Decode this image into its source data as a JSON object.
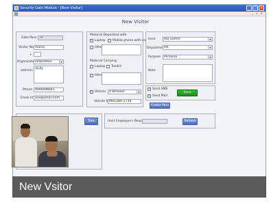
{
  "window": {
    "title": "Security Gate Module - [New Visitor]"
  },
  "form_title": "New Visitor",
  "visitor": {
    "gate_pass_label": "Gate Pass no.",
    "gate_pass_value": "34",
    "name_label": "Visitor Name",
    "name_value": "manoj",
    "plus": "+",
    "org_label": "Organization",
    "org_value": "embedded",
    "address_label": "address",
    "address_value": "dcjdy",
    "phone_label": "Phone",
    "phone_value": "9990096641",
    "email_label": "Email Id",
    "email_value": "xxx@ymail.com"
  },
  "material_deposit": {
    "title": "Material Deposited with",
    "laptop": "Laptop",
    "laptop_checked": true,
    "mobile_camera": "Mobile phone with camera",
    "mobile_camera_checked": false,
    "other": "Other",
    "other_checked": false
  },
  "material_carrying": {
    "title": "Material Carrying",
    "laptop": "Laptop",
    "toolkit": "Toolkit",
    "other": "Other",
    "vehicle": "Vehicle",
    "vehicle_checked": true,
    "vehicle_type": "4 Wheeler",
    "vehicle_no_label": "Vehicle No",
    "vehicle_no_value": "MH12BH 2739"
  },
  "meeting": {
    "host_label": "Host",
    "host_value": "Raj Gamre",
    "dept_label": "Department",
    "dept_value": "sdi",
    "purpose_label": "Purpose",
    "purpose_value": "Personal",
    "note_label": "Note"
  },
  "notify": {
    "send_sms": "Send SMS",
    "send_sms_checked": true,
    "send_mail": "Send Mail",
    "send_mail_checked": true,
    "save": "Save",
    "create_pass": "Create Pass"
  },
  "photo": {
    "take_photo": "Take Photo"
  },
  "response": {
    "label": "Host Employee's Response",
    "refresh": "Refresh"
  },
  "caption": "New Vsitor",
  "colors": {
    "titlebar": "#2a56b8",
    "save": "#1e8f1e",
    "button": "#4f6fb4"
  }
}
